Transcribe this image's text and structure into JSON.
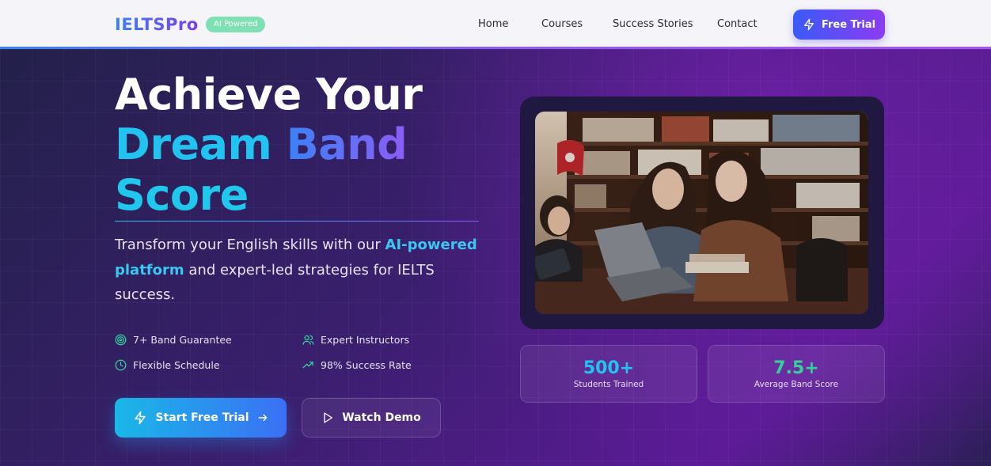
{
  "brand": {
    "logo": "IELTSPro",
    "badge": "AI Powered"
  },
  "nav": {
    "links": [
      "Home",
      "Courses",
      "Success Stories",
      "Contact"
    ],
    "cta": "Free Trial"
  },
  "hero": {
    "line1": "Achieve Your",
    "line2a": "Dream",
    "line2b": "Band",
    "line3": "Score",
    "desc_start": "Transform your English skills with our",
    "desc_highlight": "AI-powered platform",
    "desc_end": "and expert-led strategies for IELTS success.",
    "features": [
      {
        "icon": "target-icon",
        "label": "7+ Band Guarantee"
      },
      {
        "icon": "users-icon",
        "label": "Expert Instructors"
      },
      {
        "icon": "clock-icon",
        "label": "Flexible Schedule"
      },
      {
        "icon": "trending-up-icon",
        "label": "98% Success Rate"
      }
    ],
    "primary_cta": "Start Free Trial",
    "secondary_cta": "Watch Demo"
  },
  "stats": [
    {
      "value": "500+",
      "label": "Students Trained",
      "color": "#22c3f0"
    },
    {
      "value": "7.5+",
      "label": "Average Band Score",
      "color": "#34d399"
    }
  ],
  "colors": {
    "accent_cyan": "#22c3f0",
    "accent_purple": "#8b5cf6",
    "accent_green": "#34d399"
  }
}
